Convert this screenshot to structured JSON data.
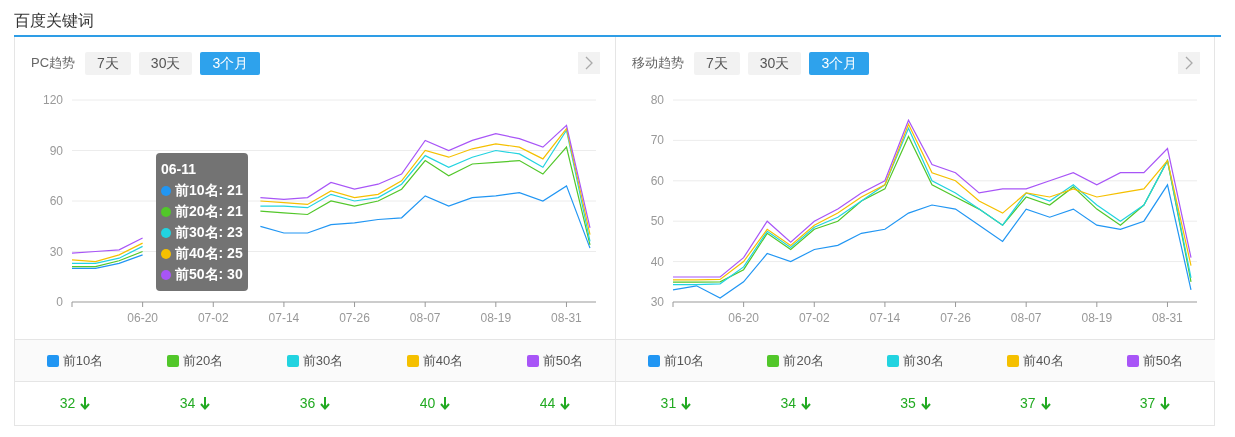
{
  "section_title": "百度关键词",
  "panels": [
    {
      "label": "PC趋势",
      "tabs": [
        {
          "label": "7天",
          "selected": false
        },
        {
          "label": "30天",
          "selected": false
        },
        {
          "label": "3个月",
          "selected": true
        }
      ],
      "chart_data": {
        "type": "line",
        "categories": [
          null,
          null,
          null,
          "06-20",
          null,
          null,
          "07-02",
          null,
          null,
          "07-14",
          null,
          null,
          "07-26",
          null,
          null,
          "08-07",
          null,
          null,
          "08-19",
          null,
          null,
          "08-31",
          null
        ],
        "ylim": [
          0,
          120
        ],
        "yticks": [
          0,
          30,
          60,
          90,
          120
        ],
        "grid": true,
        "series": [
          {
            "name": "前10名",
            "color": "#2196f3",
            "values": [
              20,
              20,
              23,
              28,
              null,
              null,
              null,
              null,
              45,
              41,
              41,
              46,
              47,
              49,
              50,
              63,
              57,
              62,
              63,
              65,
              60,
              69,
              32
            ]
          },
          {
            "name": "前20名",
            "color": "#52c72a",
            "values": [
              21,
              21,
              24.5,
              30,
              null,
              null,
              null,
              null,
              54,
              53,
              52,
              60,
              57,
              60,
              67,
              84,
              75,
              82,
              83,
              84,
              76,
              92,
              34
            ]
          },
          {
            "name": "前30名",
            "color": "#22d3e0",
            "values": [
              23,
              23,
              26,
              33,
              null,
              null,
              null,
              null,
              57,
              57,
              56,
              64,
              60,
              62,
              70,
              87,
              80,
              86,
              90,
              88,
              80,
              102,
              36
            ]
          },
          {
            "name": "前40名",
            "color": "#f5c000",
            "values": [
              25,
              24,
              28,
              35,
              null,
              null,
              null,
              null,
              60,
              59,
              58,
              66,
              62,
              64,
              72,
              90,
              86,
              91,
              94,
              92,
              85,
              103,
              40
            ]
          },
          {
            "name": "前50名",
            "color": "#a855f7",
            "values": [
              29,
              30,
              31,
              38,
              null,
              null,
              null,
              null,
              62,
              61,
              62,
              71,
              67,
              70,
              76,
              96,
              90,
              96,
              100,
              97,
              92,
              105,
              44
            ]
          }
        ]
      },
      "tooltip": {
        "title": "06-11",
        "entries": [
          "前10名: 21",
          "前20名: 21",
          "前30名: 23",
          "前40名: 25",
          "前50名: 30"
        ]
      },
      "stats": [
        {
          "value": "32",
          "falling": true
        },
        {
          "value": "34",
          "falling": true
        },
        {
          "value": "36",
          "falling": true
        },
        {
          "value": "40",
          "falling": true
        },
        {
          "value": "44",
          "falling": true
        }
      ]
    },
    {
      "label": "移动趋势",
      "tabs": [
        {
          "label": "7天",
          "selected": false
        },
        {
          "label": "30天",
          "selected": false
        },
        {
          "label": "3个月",
          "selected": true
        }
      ],
      "chart_data": {
        "type": "line",
        "categories": [
          null,
          null,
          null,
          "06-20",
          null,
          null,
          "07-02",
          null,
          null,
          "07-14",
          null,
          null,
          "07-26",
          null,
          null,
          "08-07",
          null,
          null,
          "08-19",
          null,
          null,
          "08-31",
          null
        ],
        "ylim": [
          30,
          80
        ],
        "yticks": [
          30,
          40,
          50,
          60,
          70,
          80
        ],
        "grid": true,
        "series": [
          {
            "name": "前10名",
            "color": "#2196f3",
            "values": [
              33,
              34,
              31,
              35,
              42,
              40,
              43,
              44,
              47,
              48,
              52,
              54,
              53,
              49,
              45,
              53,
              51,
              53,
              49,
              48,
              50,
              59,
              33
            ]
          },
          {
            "name": "前20名",
            "color": "#52c72a",
            "values": [
              34.9,
              34.9,
              35,
              38,
              47,
              43,
              48,
              50,
              55,
              58,
              71,
              59,
              56,
              53,
              49,
              56,
              54,
              58.5,
              53,
              49,
              54,
              65,
              35
            ]
          },
          {
            "name": "前30名",
            "color": "#22d3e0",
            "values": [
              34.3,
              34.3,
              34.5,
              38.7,
              47.5,
              43.5,
              48.5,
              51,
              55,
              59,
              73,
              60,
              57,
              53,
              49,
              57,
              55,
              59,
              54,
              50,
              54,
              65,
              36
            ]
          },
          {
            "name": "前40名",
            "color": "#f5c000",
            "values": [
              35.5,
              35.5,
              35.6,
              40,
              48,
              44,
              49,
              52,
              56,
              59,
              74,
              62,
              60,
              55,
              52,
              57,
              56,
              58,
              56,
              57,
              58,
              65,
              39
            ]
          },
          {
            "name": "前50名",
            "color": "#a855f7",
            "values": [
              36.2,
              36.2,
              36.2,
              41,
              50,
              44.8,
              50,
              53,
              57,
              60,
              75,
              64,
              62,
              57,
              58,
              58,
              60,
              62,
              59,
              62,
              62,
              68,
              41
            ]
          }
        ]
      },
      "stats": [
        {
          "value": "31",
          "falling": true
        },
        {
          "value": "34",
          "falling": true
        },
        {
          "value": "35",
          "falling": true
        },
        {
          "value": "37",
          "falling": true
        },
        {
          "value": "37",
          "falling": true
        }
      ]
    }
  ]
}
